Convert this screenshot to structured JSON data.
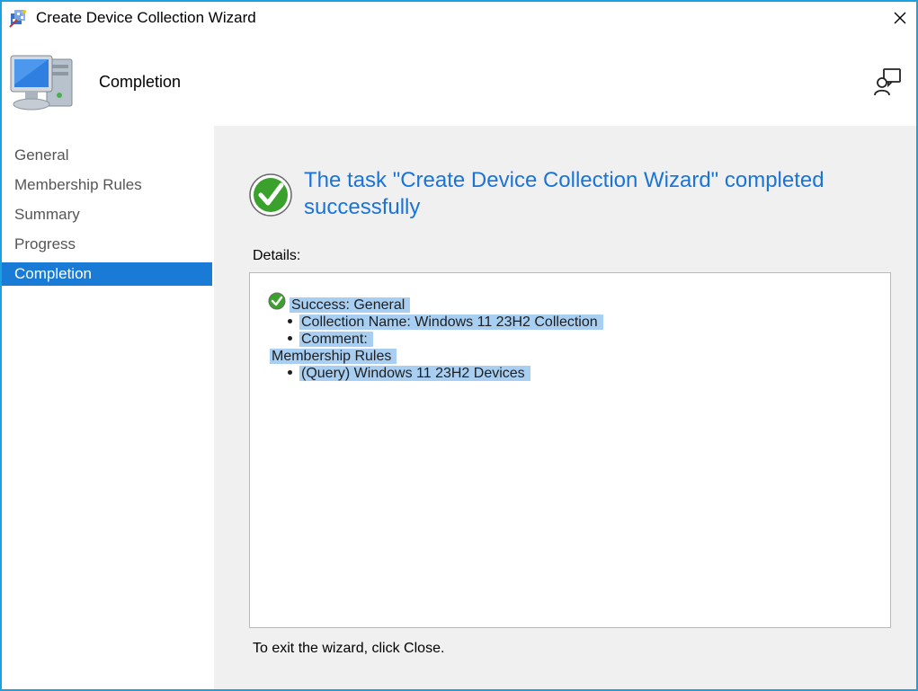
{
  "window": {
    "title": "Create Device Collection Wizard",
    "close_glyph": "✕"
  },
  "header": {
    "title": "Completion",
    "icons": [
      "wizard-app-icon",
      "computer-icon",
      "help-user-icon"
    ]
  },
  "nav": {
    "items": [
      {
        "label": "General"
      },
      {
        "label": "Membership Rules"
      },
      {
        "label": "Summary"
      },
      {
        "label": "Progress"
      },
      {
        "label": "Completion"
      }
    ],
    "active_index": 4
  },
  "content": {
    "headline": "The task \"Create Device Collection Wizard\" completed successfully",
    "details_label": "Details:",
    "details": {
      "success_line": "Success: General",
      "collection_name": "Collection Name: Windows 11 23H2 Collection",
      "comment": "Comment:",
      "membership_rules": "Membership Rules",
      "query_rule": "(Query) Windows 11 23H2 Devices"
    },
    "exit_text": "To exit the wizard, click Close."
  },
  "colors": {
    "window_border": "#1ba1e2",
    "active_nav": "#1a7bd6",
    "headline": "#1a74d8",
    "selection": "#a8cff2",
    "success_green": "#3aa22c"
  }
}
